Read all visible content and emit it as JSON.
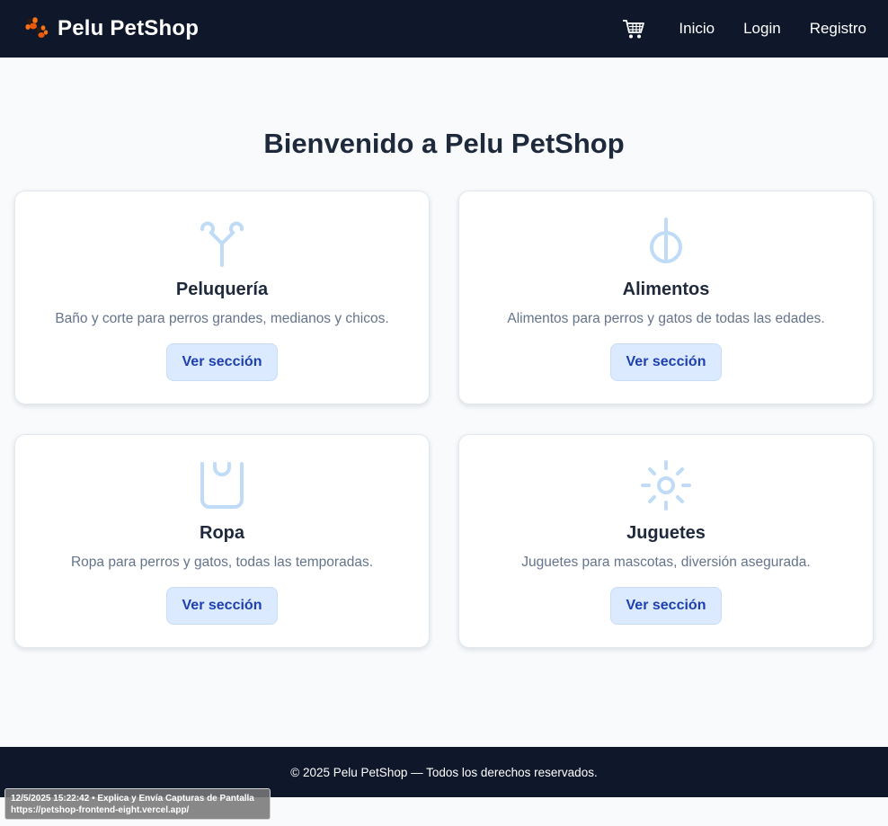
{
  "header": {
    "brand": "Pelu PetShop",
    "logo_icon": "paw-icon",
    "cart_icon": "cart-icon",
    "nav": [
      "Inicio",
      "Login",
      "Registro"
    ]
  },
  "main": {
    "title": "Bienvenido a Pelu PetShop",
    "cards": [
      {
        "icon": "scissors-icon",
        "title": "Peluquería",
        "description": "Baño y corte para perros grandes, medianos y chicos.",
        "button": "Ver sección"
      },
      {
        "icon": "food-icon",
        "title": "Alimentos",
        "description": "Alimentos para perros y gatos de todas las edades.",
        "button": "Ver sección"
      },
      {
        "icon": "shirt-icon",
        "title": "Ropa",
        "description": "Ropa para perros y gatos, todas las temporadas.",
        "button": "Ver sección"
      },
      {
        "icon": "toy-icon",
        "title": "Juguetes",
        "description": "Juguetes para mascotas, diversión asegurada.",
        "button": "Ver sección"
      }
    ]
  },
  "footer": {
    "text": "© 2025 Pelu PetShop — Todos los derechos reservados."
  },
  "overlay": {
    "line1": "12/5/2025 15:22:42 • Explica y Envía Capturas de Pantalla",
    "line2": "https://petshop-frontend-eight.vercel.app/"
  },
  "colors": {
    "navbar": "#0f172a",
    "background": "#f8fafc",
    "button_bg": "#dbeafe",
    "button_text": "#1e40af",
    "icon": "#bfdbf5"
  }
}
